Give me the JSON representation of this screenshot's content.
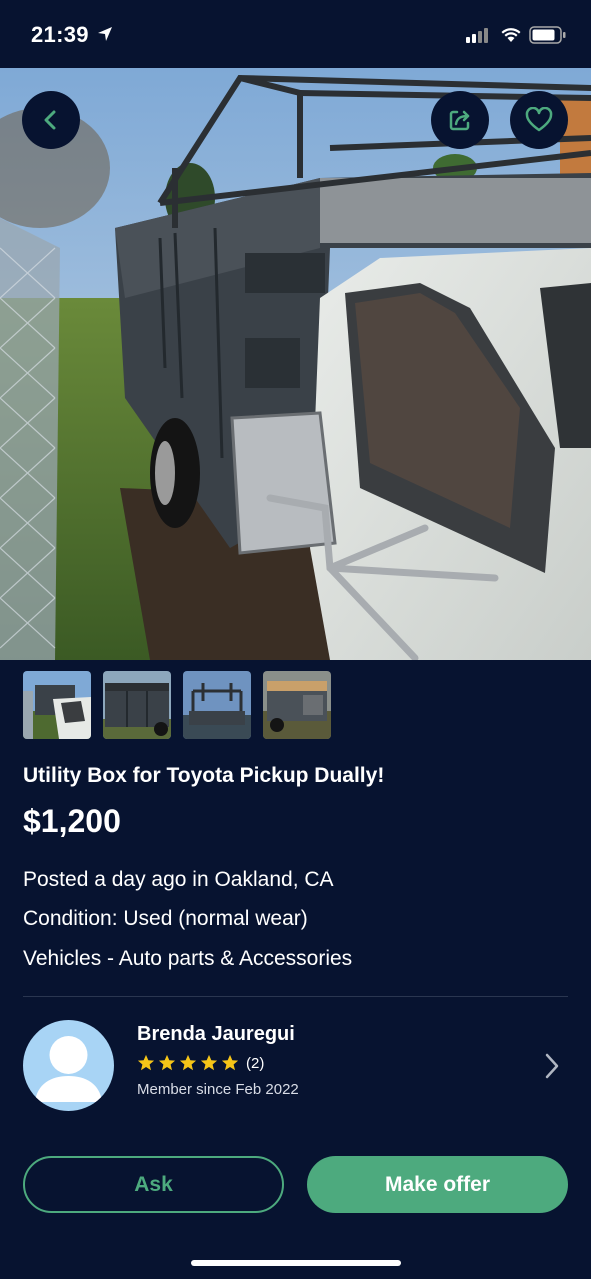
{
  "status_bar": {
    "time": "21:39"
  },
  "hero": {
    "image_description": "",
    "back_icon": "chevron-left-icon",
    "share_icon": "share-icon",
    "favorite_icon": "heart-icon"
  },
  "thumbnails": [
    {
      "name": "thumbnail-1"
    },
    {
      "name": "thumbnail-2"
    },
    {
      "name": "thumbnail-3"
    },
    {
      "name": "thumbnail-4"
    }
  ],
  "listing": {
    "title": "Utility Box for Toyota Pickup Dually!",
    "price": "$1,200",
    "posted": "Posted a day ago in Oakland, CA",
    "condition": "Condition: Used (normal wear)",
    "category": "Vehicles - Auto parts & Accessories"
  },
  "seller": {
    "name": "Brenda Jauregui",
    "rating": 5,
    "review_count": "(2)",
    "member_since": "Member since Feb 2022"
  },
  "actions": {
    "ask_label": "Ask",
    "offer_label": "Make offer"
  },
  "colors": {
    "background": "#071330",
    "accent_green": "#4daa7e",
    "star_yellow": "#f5c518"
  }
}
